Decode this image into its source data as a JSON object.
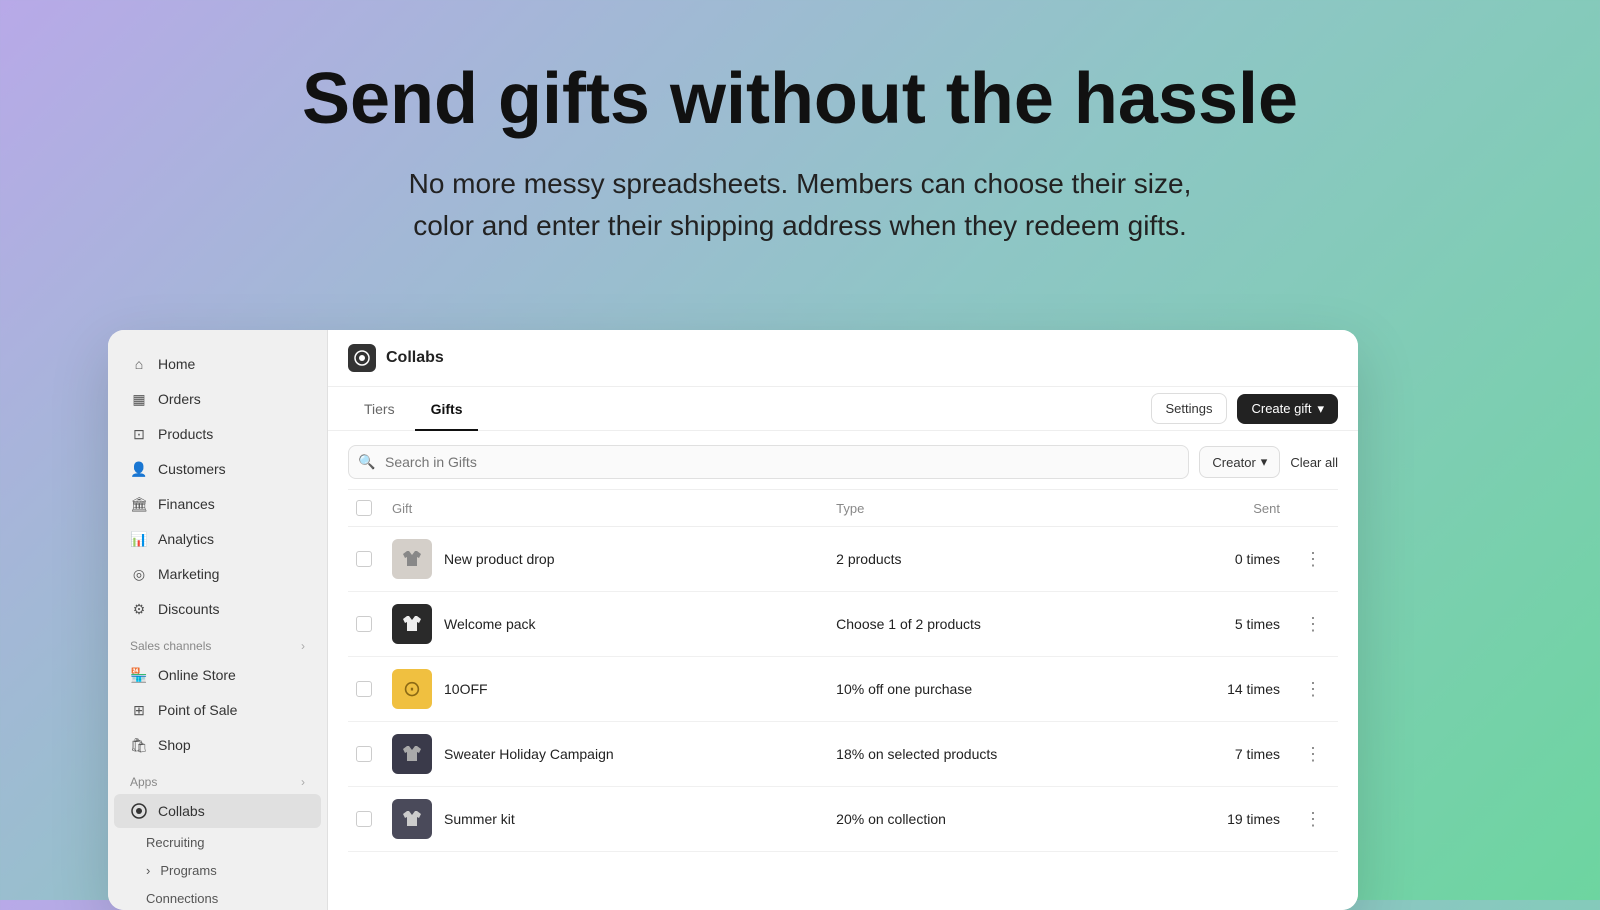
{
  "hero": {
    "title": "Send gifts without the hassle",
    "subtitle_line1": "No more messy spreadsheets. Members can choose their size,",
    "subtitle_line2": "color and enter their shipping address when they redeem gifts."
  },
  "sidebar": {
    "main_nav": [
      {
        "id": "home",
        "label": "Home",
        "icon": "home"
      },
      {
        "id": "orders",
        "label": "Orders",
        "icon": "orders"
      },
      {
        "id": "products",
        "label": "Products",
        "icon": "products"
      },
      {
        "id": "customers",
        "label": "Customers",
        "icon": "customers"
      },
      {
        "id": "finances",
        "label": "Finances",
        "icon": "finances"
      },
      {
        "id": "analytics",
        "label": "Analytics",
        "icon": "analytics"
      },
      {
        "id": "marketing",
        "label": "Marketing",
        "icon": "marketing"
      },
      {
        "id": "discounts",
        "label": "Discounts",
        "icon": "discounts"
      }
    ],
    "sales_channels_label": "Sales channels",
    "sales_channels": [
      {
        "id": "online-store",
        "label": "Online Store",
        "icon": "store"
      },
      {
        "id": "pos",
        "label": "Point of Sale",
        "icon": "pos"
      },
      {
        "id": "shop",
        "label": "Shop",
        "icon": "shop"
      }
    ],
    "apps_label": "Apps",
    "apps": [
      {
        "id": "collabs",
        "label": "Collabs",
        "icon": "collabs",
        "active": true
      }
    ],
    "sub_items": [
      {
        "id": "recruiting",
        "label": "Recruiting"
      },
      {
        "id": "programs",
        "label": "Programs"
      },
      {
        "id": "connections",
        "label": "Connections"
      }
    ]
  },
  "top_bar": {
    "app_name": "Collabs"
  },
  "tabs": [
    {
      "id": "tiers",
      "label": "Tiers",
      "active": false
    },
    {
      "id": "gifts",
      "label": "Gifts",
      "active": true
    }
  ],
  "actions": {
    "settings_label": "Settings",
    "create_gift_label": "Create gift"
  },
  "search": {
    "placeholder": "Search in Gifts"
  },
  "filters": {
    "creator_label": "Creator",
    "clear_all_label": "Clear all"
  },
  "table": {
    "columns": [
      {
        "id": "gift",
        "label": "Gift"
      },
      {
        "id": "type",
        "label": "Type"
      },
      {
        "id": "sent",
        "label": "Sent"
      }
    ],
    "rows": [
      {
        "id": "row-1",
        "name": "New product drop",
        "type": "2 products",
        "sent": "0 times",
        "thumb_style": "shirt",
        "thumb_char": ""
      },
      {
        "id": "row-2",
        "name": "Welcome pack",
        "type": "Choose 1 of 2 products",
        "sent": "5 times",
        "thumb_style": "black-shirt",
        "thumb_char": ""
      },
      {
        "id": "row-3",
        "name": "10OFF",
        "type": "10% off one purchase",
        "sent": "14 times",
        "thumb_style": "coin",
        "thumb_char": "⊙"
      },
      {
        "id": "row-4",
        "name": "Sweater Holiday Campaign",
        "type": "18% on selected products",
        "sent": "7 times",
        "thumb_style": "dark-jacket",
        "thumb_char": ""
      },
      {
        "id": "row-5",
        "name": "Summer kit",
        "type": "20% on collection",
        "sent": "19 times",
        "thumb_style": "kit",
        "thumb_char": ""
      }
    ]
  }
}
